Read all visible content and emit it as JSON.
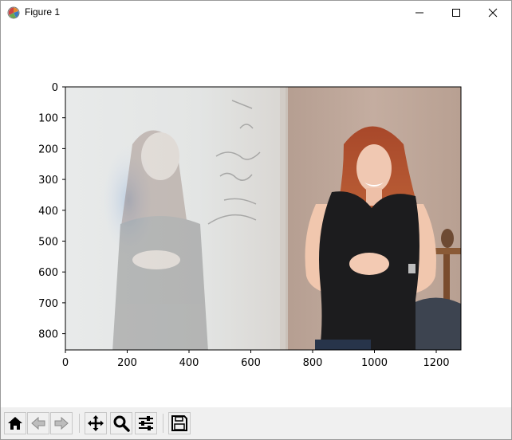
{
  "window": {
    "title": "Figure 1",
    "icons": {
      "app": "matplotlib-figure-icon",
      "minimize": "minimize-icon",
      "maximize": "maximize-icon",
      "close": "close-icon"
    }
  },
  "plot": {
    "image_description_icon": "image-display",
    "x_ticks": [
      "0",
      "200",
      "400",
      "600",
      "800",
      "1000",
      "1200"
    ],
    "y_ticks": [
      "0",
      "100",
      "200",
      "300",
      "400",
      "500",
      "600",
      "700",
      "800"
    ],
    "x_range": [
      0,
      1280
    ],
    "y_range": [
      0,
      853
    ]
  },
  "toolbar": {
    "buttons": [
      {
        "name": "home-button",
        "icon": "home-icon"
      },
      {
        "name": "back-button",
        "icon": "back-arrow-icon"
      },
      {
        "name": "forward-button",
        "icon": "forward-arrow-icon"
      },
      {
        "name": "pan-button",
        "icon": "pan-move-icon"
      },
      {
        "name": "zoom-button",
        "icon": "zoom-magnifier-icon"
      },
      {
        "name": "configure-subplots-button",
        "icon": "sliders-icon"
      },
      {
        "name": "save-button",
        "icon": "floppy-disk-icon"
      }
    ]
  }
}
